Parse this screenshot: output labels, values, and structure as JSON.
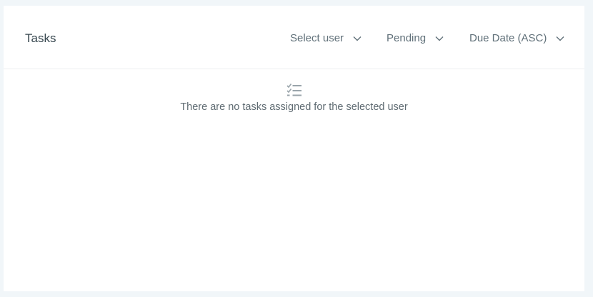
{
  "card": {
    "title": "Tasks"
  },
  "filters": {
    "user": {
      "selected": "Select user",
      "icon": "chevron-down-icon"
    },
    "status": {
      "selected": "Pending",
      "icon": "chevron-down-icon"
    },
    "sort": {
      "selected": "Due Date (ASC)",
      "icon": "chevron-down-icon"
    }
  },
  "empty_state": {
    "icon": "checklist-icon",
    "message": "There are no tasks assigned for the selected user"
  },
  "colors": {
    "background": "#f1f6f9",
    "card": "#ffffff",
    "text_primary": "#37474f",
    "text_secondary": "#607079",
    "icon": "#9aa5ab"
  }
}
